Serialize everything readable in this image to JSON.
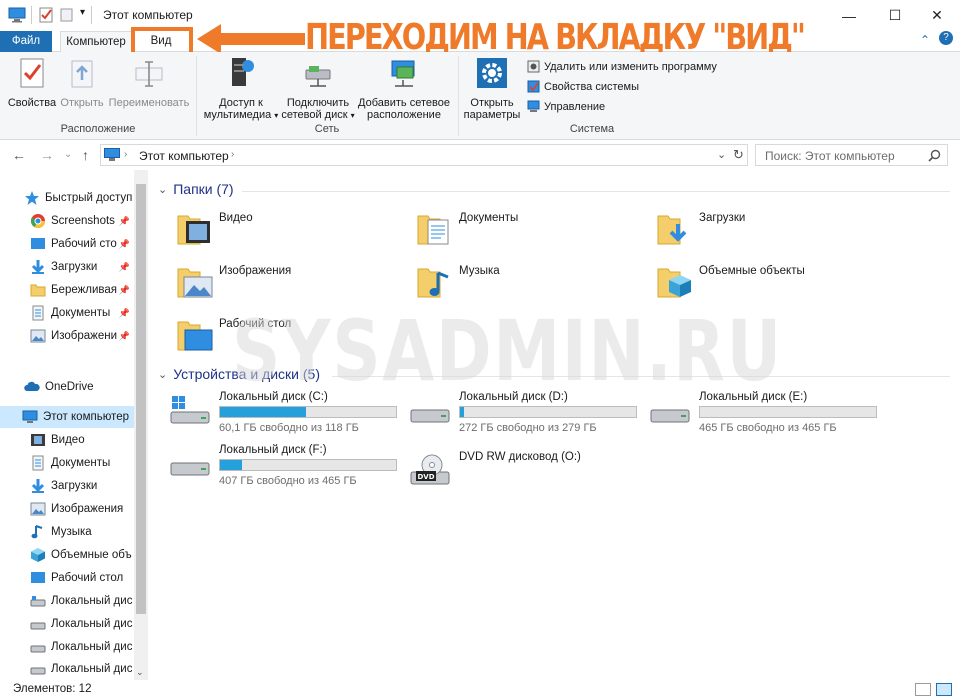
{
  "window": {
    "title": "Этот компьютер",
    "minimize": "—",
    "maximize": "☐",
    "close": "✕"
  },
  "ribbon_tabs": {
    "file": "Файл",
    "computer": "Компьютер",
    "view": "Вид"
  },
  "annotation": {
    "text": "ПЕРЕХОДИМ НА ВКЛАДКУ \"ВИД\"",
    "color": "#ef7a2a"
  },
  "ribbon": {
    "location_group": {
      "label": "Расположение",
      "properties": "Свойства",
      "open": "Открыть",
      "rename": "Переименовать"
    },
    "network_group": {
      "label": "Сеть",
      "media_access_line1": "Доступ к",
      "media_access_line2": "мультимедиа",
      "map_drive_line1": "Подключить",
      "map_drive_line2": "сетевой диск",
      "add_location_line1": "Добавить сетевое",
      "add_location_line2": "расположение"
    },
    "system_group": {
      "label": "Система",
      "open_settings_line1": "Открыть",
      "open_settings_line2": "параметры",
      "uninstall": "Удалить или изменить программу",
      "system_properties": "Свойства системы",
      "manage": "Управление"
    }
  },
  "address": {
    "path": "Этот компьютер",
    "search_placeholder": "Поиск: Этот компьютер"
  },
  "sidebar": {
    "items": [
      {
        "label": "Быстрый доступ",
        "icon": "star-icon"
      },
      {
        "label": "Screenshots",
        "icon": "chrome-icon"
      },
      {
        "label": "Рабочий сто",
        "icon": "desktop-icon"
      },
      {
        "label": "Загрузки",
        "icon": "download-icon"
      },
      {
        "label": "Бережливая",
        "icon": "folder-icon"
      },
      {
        "label": "Документы",
        "icon": "document-icon"
      },
      {
        "label": "Изображени",
        "icon": "image-icon"
      },
      {
        "label": "OneDrive",
        "icon": "cloud-icon"
      },
      {
        "label": "Этот компьютер",
        "icon": "computer-icon"
      },
      {
        "label": "Видео",
        "icon": "video-icon"
      },
      {
        "label": "Документы",
        "icon": "document-icon"
      },
      {
        "label": "Загрузки",
        "icon": "download-icon"
      },
      {
        "label": "Изображения",
        "icon": "image-icon"
      },
      {
        "label": "Музыка",
        "icon": "music-icon"
      },
      {
        "label": "Объемные объ",
        "icon": "cube-icon"
      },
      {
        "label": "Рабочий стол",
        "icon": "desktop-icon"
      },
      {
        "label": "Локальный дис",
        "icon": "drive-icon"
      },
      {
        "label": "Локальный дис",
        "icon": "drive-icon"
      },
      {
        "label": "Локальный дис",
        "icon": "drive-icon"
      },
      {
        "label": "Локальный дис",
        "icon": "drive-icon"
      }
    ]
  },
  "content": {
    "folders_header": "Папки (7)",
    "folders": [
      {
        "name": "Видео"
      },
      {
        "name": "Документы"
      },
      {
        "name": "Загрузки"
      },
      {
        "name": "Изображения"
      },
      {
        "name": "Музыка"
      },
      {
        "name": "Объемные объекты"
      },
      {
        "name": "Рабочий стол"
      }
    ],
    "devices_header": "Устройства и диски (5)",
    "drives": [
      {
        "name": "Локальный диск (C:)",
        "free": "60,1 ГБ свободно из 118 ГБ",
        "used_fraction": 0.49
      },
      {
        "name": "Локальный диск (D:)",
        "free": "272 ГБ свободно из 279 ГБ",
        "used_fraction": 0.025
      },
      {
        "name": "Локальный диск (E:)",
        "free": "465 ГБ свободно из 465 ГБ",
        "used_fraction": 0.0
      },
      {
        "name": "Локальный диск (F:)",
        "free": "407 ГБ свободно из 465 ГБ",
        "used_fraction": 0.125
      },
      {
        "name": "DVD RW дисковод (O:)"
      }
    ]
  },
  "watermark": "SYSADMIN.RU",
  "status": {
    "items_count": "Элементов: 12"
  }
}
